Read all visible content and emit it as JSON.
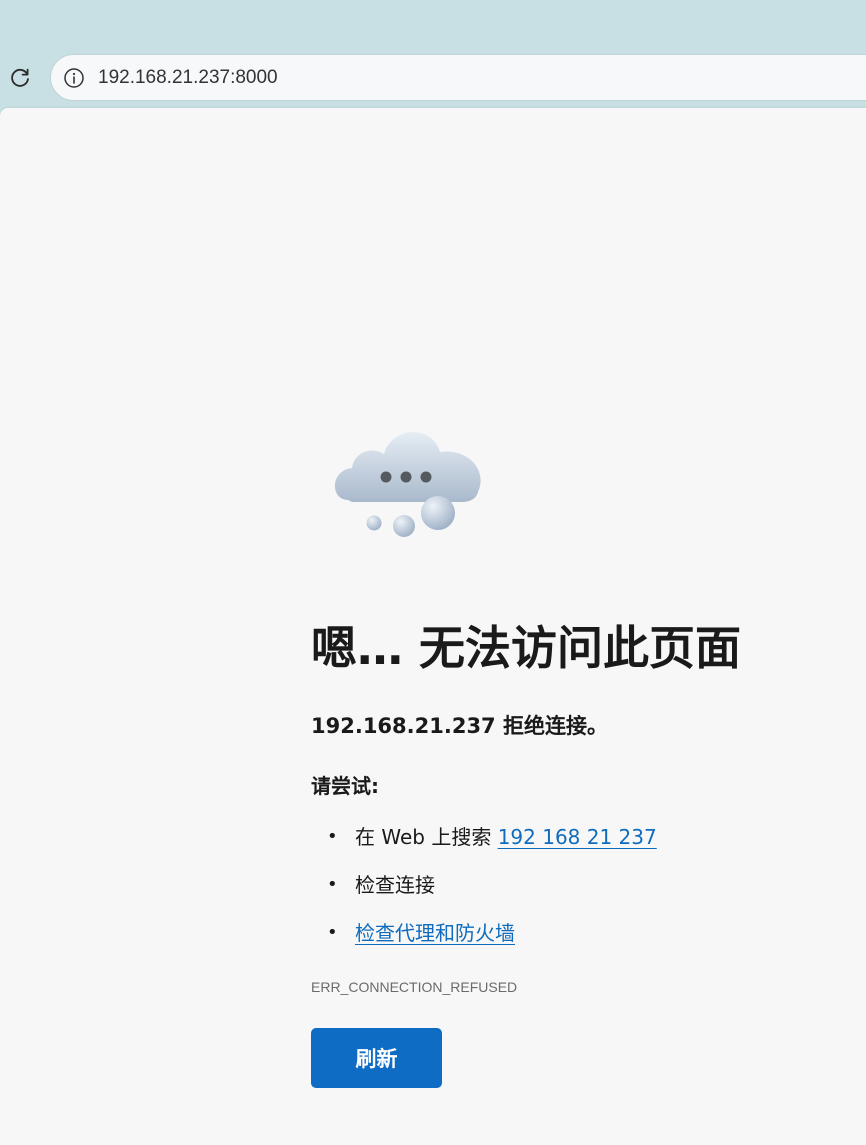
{
  "browser": {
    "url": "192.168.21.237:8000"
  },
  "error_page": {
    "title": "嗯… 无法访问此页面",
    "subtitle": "192.168.21.237 拒绝连接。",
    "try_label": "请尝试:",
    "suggestions": [
      {
        "prefix": "在 Web 上搜索 ",
        "link": "192 168 21 237"
      },
      {
        "text": "检查连接"
      },
      {
        "link": "检查代理和防火墙"
      }
    ],
    "error_code": "ERR_CONNECTION_REFUSED",
    "refresh_label": "刷新"
  },
  "icons": [
    "reload-icon",
    "info-icon",
    "cloud-icon"
  ],
  "colors": {
    "toolbar_bg": "#c8e0e4",
    "page_bg": "#f7f7f7",
    "link": "#0f6cbd",
    "button": "#0f6cc4"
  }
}
